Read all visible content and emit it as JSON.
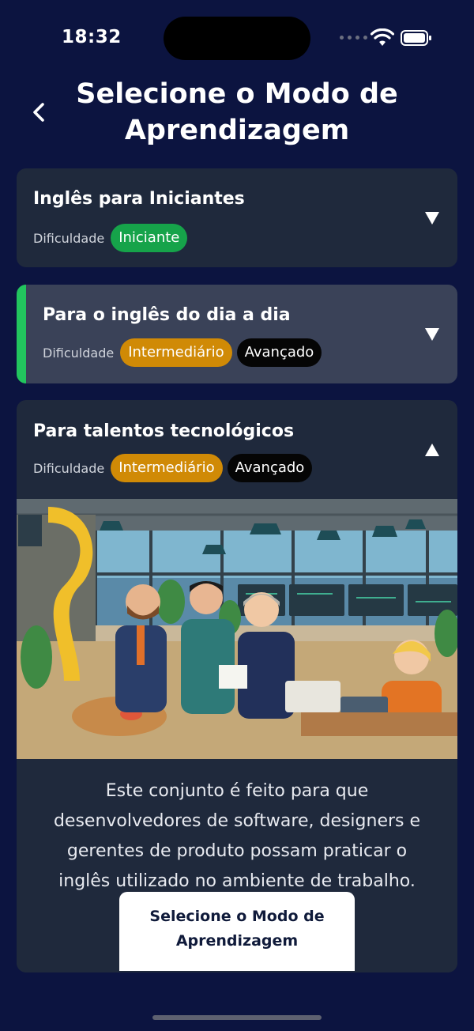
{
  "status_bar": {
    "time": "18:32"
  },
  "header": {
    "title": "Selecione o Modo de Aprendizagem",
    "back_icon": "chevron-left-icon"
  },
  "cards": [
    {
      "title": "Inglês para Iniciantes",
      "difficulty_label": "Dificuldade",
      "badges": [
        "Iniciante"
      ],
      "expanded": false,
      "selected": false
    },
    {
      "title": "Para o inglês do dia a dia",
      "difficulty_label": "Dificuldade",
      "badges": [
        "Intermediário",
        "Avançado"
      ],
      "expanded": false,
      "selected": true
    },
    {
      "title": "Para talentos tecnológicos",
      "difficulty_label": "Dificuldade",
      "badges": [
        "Intermediário",
        "Avançado"
      ],
      "expanded": true,
      "selected": false,
      "description": "Este conjunto é feito para que desenvolvedores de software, designers e gerentes de produto possam praticar o inglês utilizado no ambiente de trabalho.",
      "button_label": "Selecione o Modo de Aprendizagem"
    }
  ],
  "colors": {
    "background": "#0c1440",
    "card": "#1f293c",
    "card_selected": "#3a4258",
    "accent": "#22c55e",
    "badge_beginner": "#16a34a",
    "badge_intermediate": "#d08a06",
    "badge_advanced": "#050505"
  }
}
